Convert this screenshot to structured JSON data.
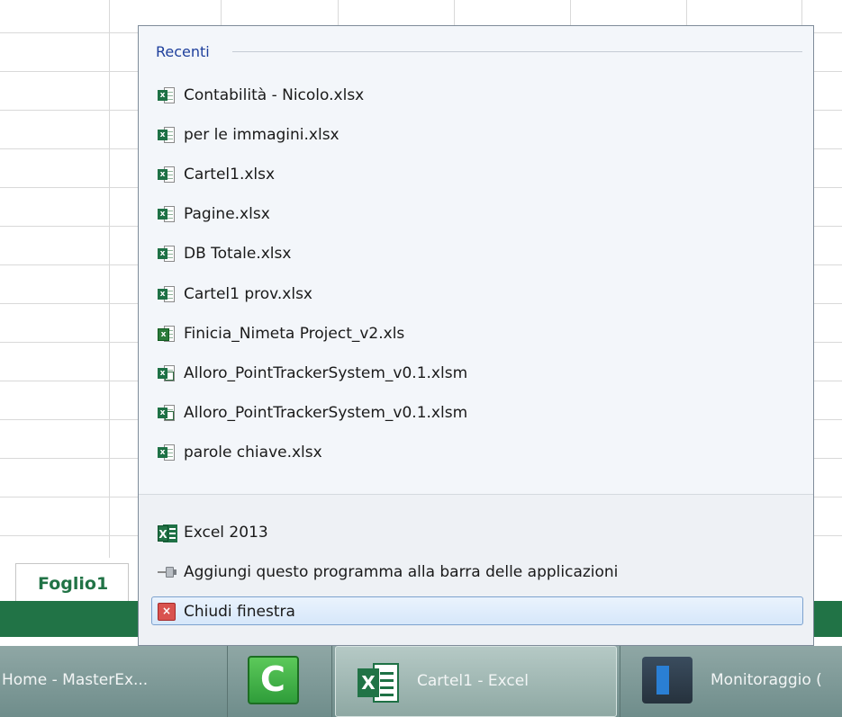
{
  "jumplist": {
    "recent_header": "Recenti",
    "recent_items": [
      {
        "label": "Contabilità - Nicolo.xlsx",
        "icon": "xlsx-file-icon"
      },
      {
        "label": "per le immagini.xlsx",
        "icon": "xlsx-file-icon"
      },
      {
        "label": "Cartel1.xlsx",
        "icon": "xlsx-file-icon"
      },
      {
        "label": "Pagine.xlsx",
        "icon": "xlsx-file-icon"
      },
      {
        "label": "DB Totale.xlsx",
        "icon": "xlsx-file-icon"
      },
      {
        "label": "Cartel1 prov.xlsx",
        "icon": "xlsx-file-icon"
      },
      {
        "label": "Finicia_Nimeta Project_v2.xls",
        "icon": "xls-file-icon"
      },
      {
        "label": "Alloro_PointTrackerSystem_v0.1.xlsm",
        "icon": "xlsm-file-icon"
      },
      {
        "label": "Alloro_PointTrackerSystem_v0.1.xlsm",
        "icon": "xlsm-file-icon"
      },
      {
        "label": "parole chiave.xlsx",
        "icon": "xlsx-file-icon"
      }
    ],
    "tasks": {
      "app_label": "Excel 2013",
      "pin_label": "Aggiungi questo programma alla barra delle applicazioni",
      "close_label": "Chiudi finestra"
    }
  },
  "sheet": {
    "tab_label": "Foglio1"
  },
  "taskbar": {
    "home_label": "Home - MasterEx...",
    "excel_label": "Cartel1 - Excel",
    "monitor_label": "Monitoraggio ("
  },
  "colors": {
    "excel_green": "#217346",
    "jumplist_bg": "#f3f6fa",
    "header_blue": "#1e3f9c",
    "taskbar": "#7f9a98"
  }
}
